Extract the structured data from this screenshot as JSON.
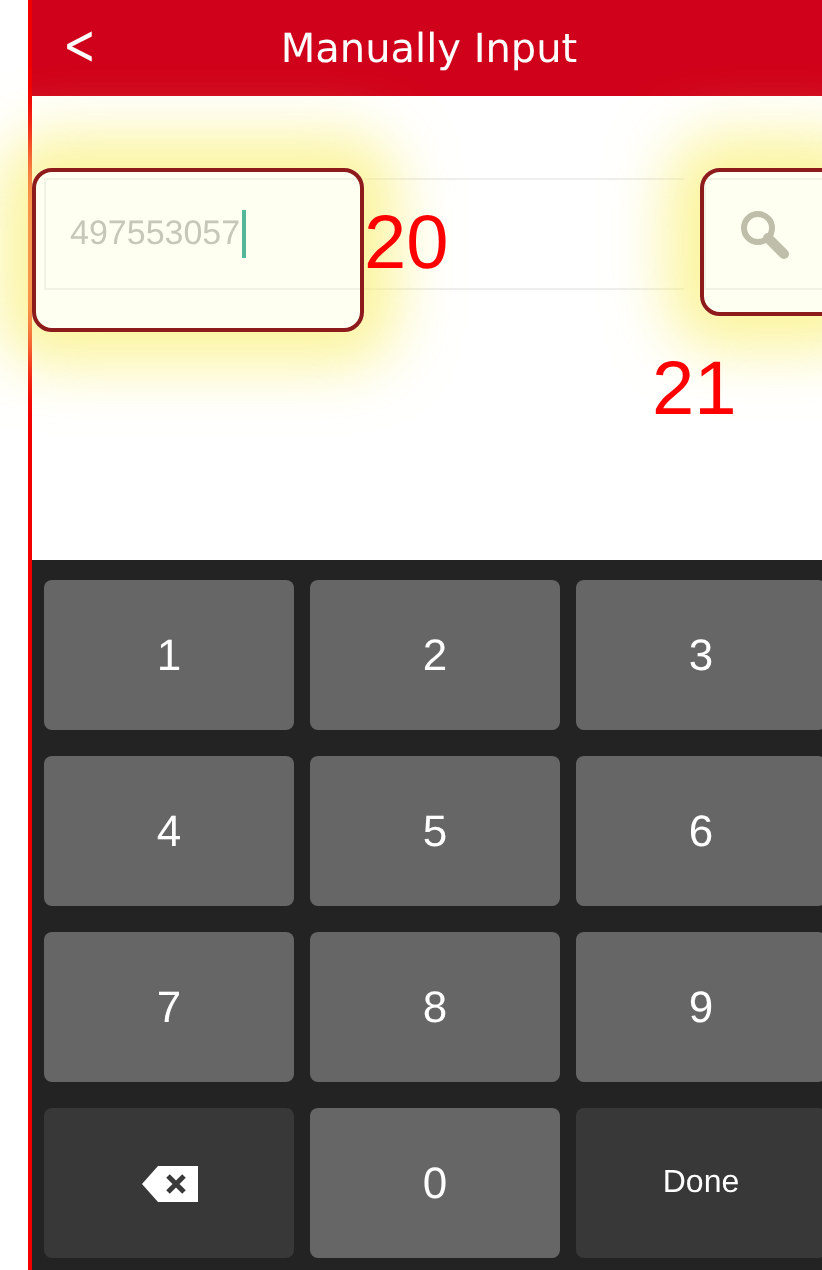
{
  "header": {
    "back": "<",
    "title": "Manually Input"
  },
  "search": {
    "value": "497553057"
  },
  "callouts": [
    {
      "label": "20",
      "kind": "field"
    },
    {
      "label": "21",
      "kind": "search"
    }
  ],
  "keypad": [
    {
      "label": "1",
      "kind": "digit"
    },
    {
      "label": "2",
      "kind": "digit"
    },
    {
      "label": "3",
      "kind": "digit"
    },
    {
      "label": "4",
      "kind": "digit"
    },
    {
      "label": "5",
      "kind": "digit"
    },
    {
      "label": "6",
      "kind": "digit"
    },
    {
      "label": "7",
      "kind": "digit"
    },
    {
      "label": "8",
      "kind": "digit"
    },
    {
      "label": "9",
      "kind": "digit"
    },
    {
      "kind": "backspace"
    },
    {
      "label": "0",
      "kind": "digit"
    },
    {
      "label": "Done",
      "kind": "action"
    }
  ]
}
